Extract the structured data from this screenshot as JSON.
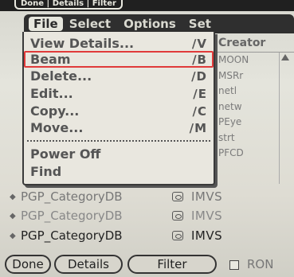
{
  "status_strip": {
    "hint_text": "Done | Details | Filter"
  },
  "menubar": {
    "items": [
      "File",
      "Select",
      "Options",
      "Set"
    ]
  },
  "file_menu": {
    "items": [
      {
        "label": "View Details...",
        "shortcut": "∕V"
      },
      {
        "label": "Beam",
        "shortcut": "∕B"
      },
      {
        "label": "Delete...",
        "shortcut": "∕D"
      },
      {
        "label": "Edit...",
        "shortcut": "∕E"
      },
      {
        "label": "Copy...",
        "shortcut": "∕C"
      },
      {
        "label": "Move...",
        "shortcut": "∕M"
      },
      {
        "label": "Power Off",
        "shortcut": ""
      },
      {
        "label": "Find",
        "shortcut": ""
      }
    ]
  },
  "creator_column": {
    "header": "Creator",
    "values": [
      "MOON",
      "MSRr",
      "netl",
      "netw",
      "PEye",
      "strt",
      "PFCD"
    ]
  },
  "db_rows": [
    {
      "name": "PGP_CategoryDB",
      "creator": "IMVS"
    },
    {
      "name": "PGP_CategoryDB",
      "creator": "IMVS"
    },
    {
      "name": "PGP_CategoryDB",
      "creator": "IMVS"
    }
  ],
  "buttons": {
    "done": "Done",
    "details": "Details",
    "filter": "Filter"
  },
  "rom_label": "RON"
}
